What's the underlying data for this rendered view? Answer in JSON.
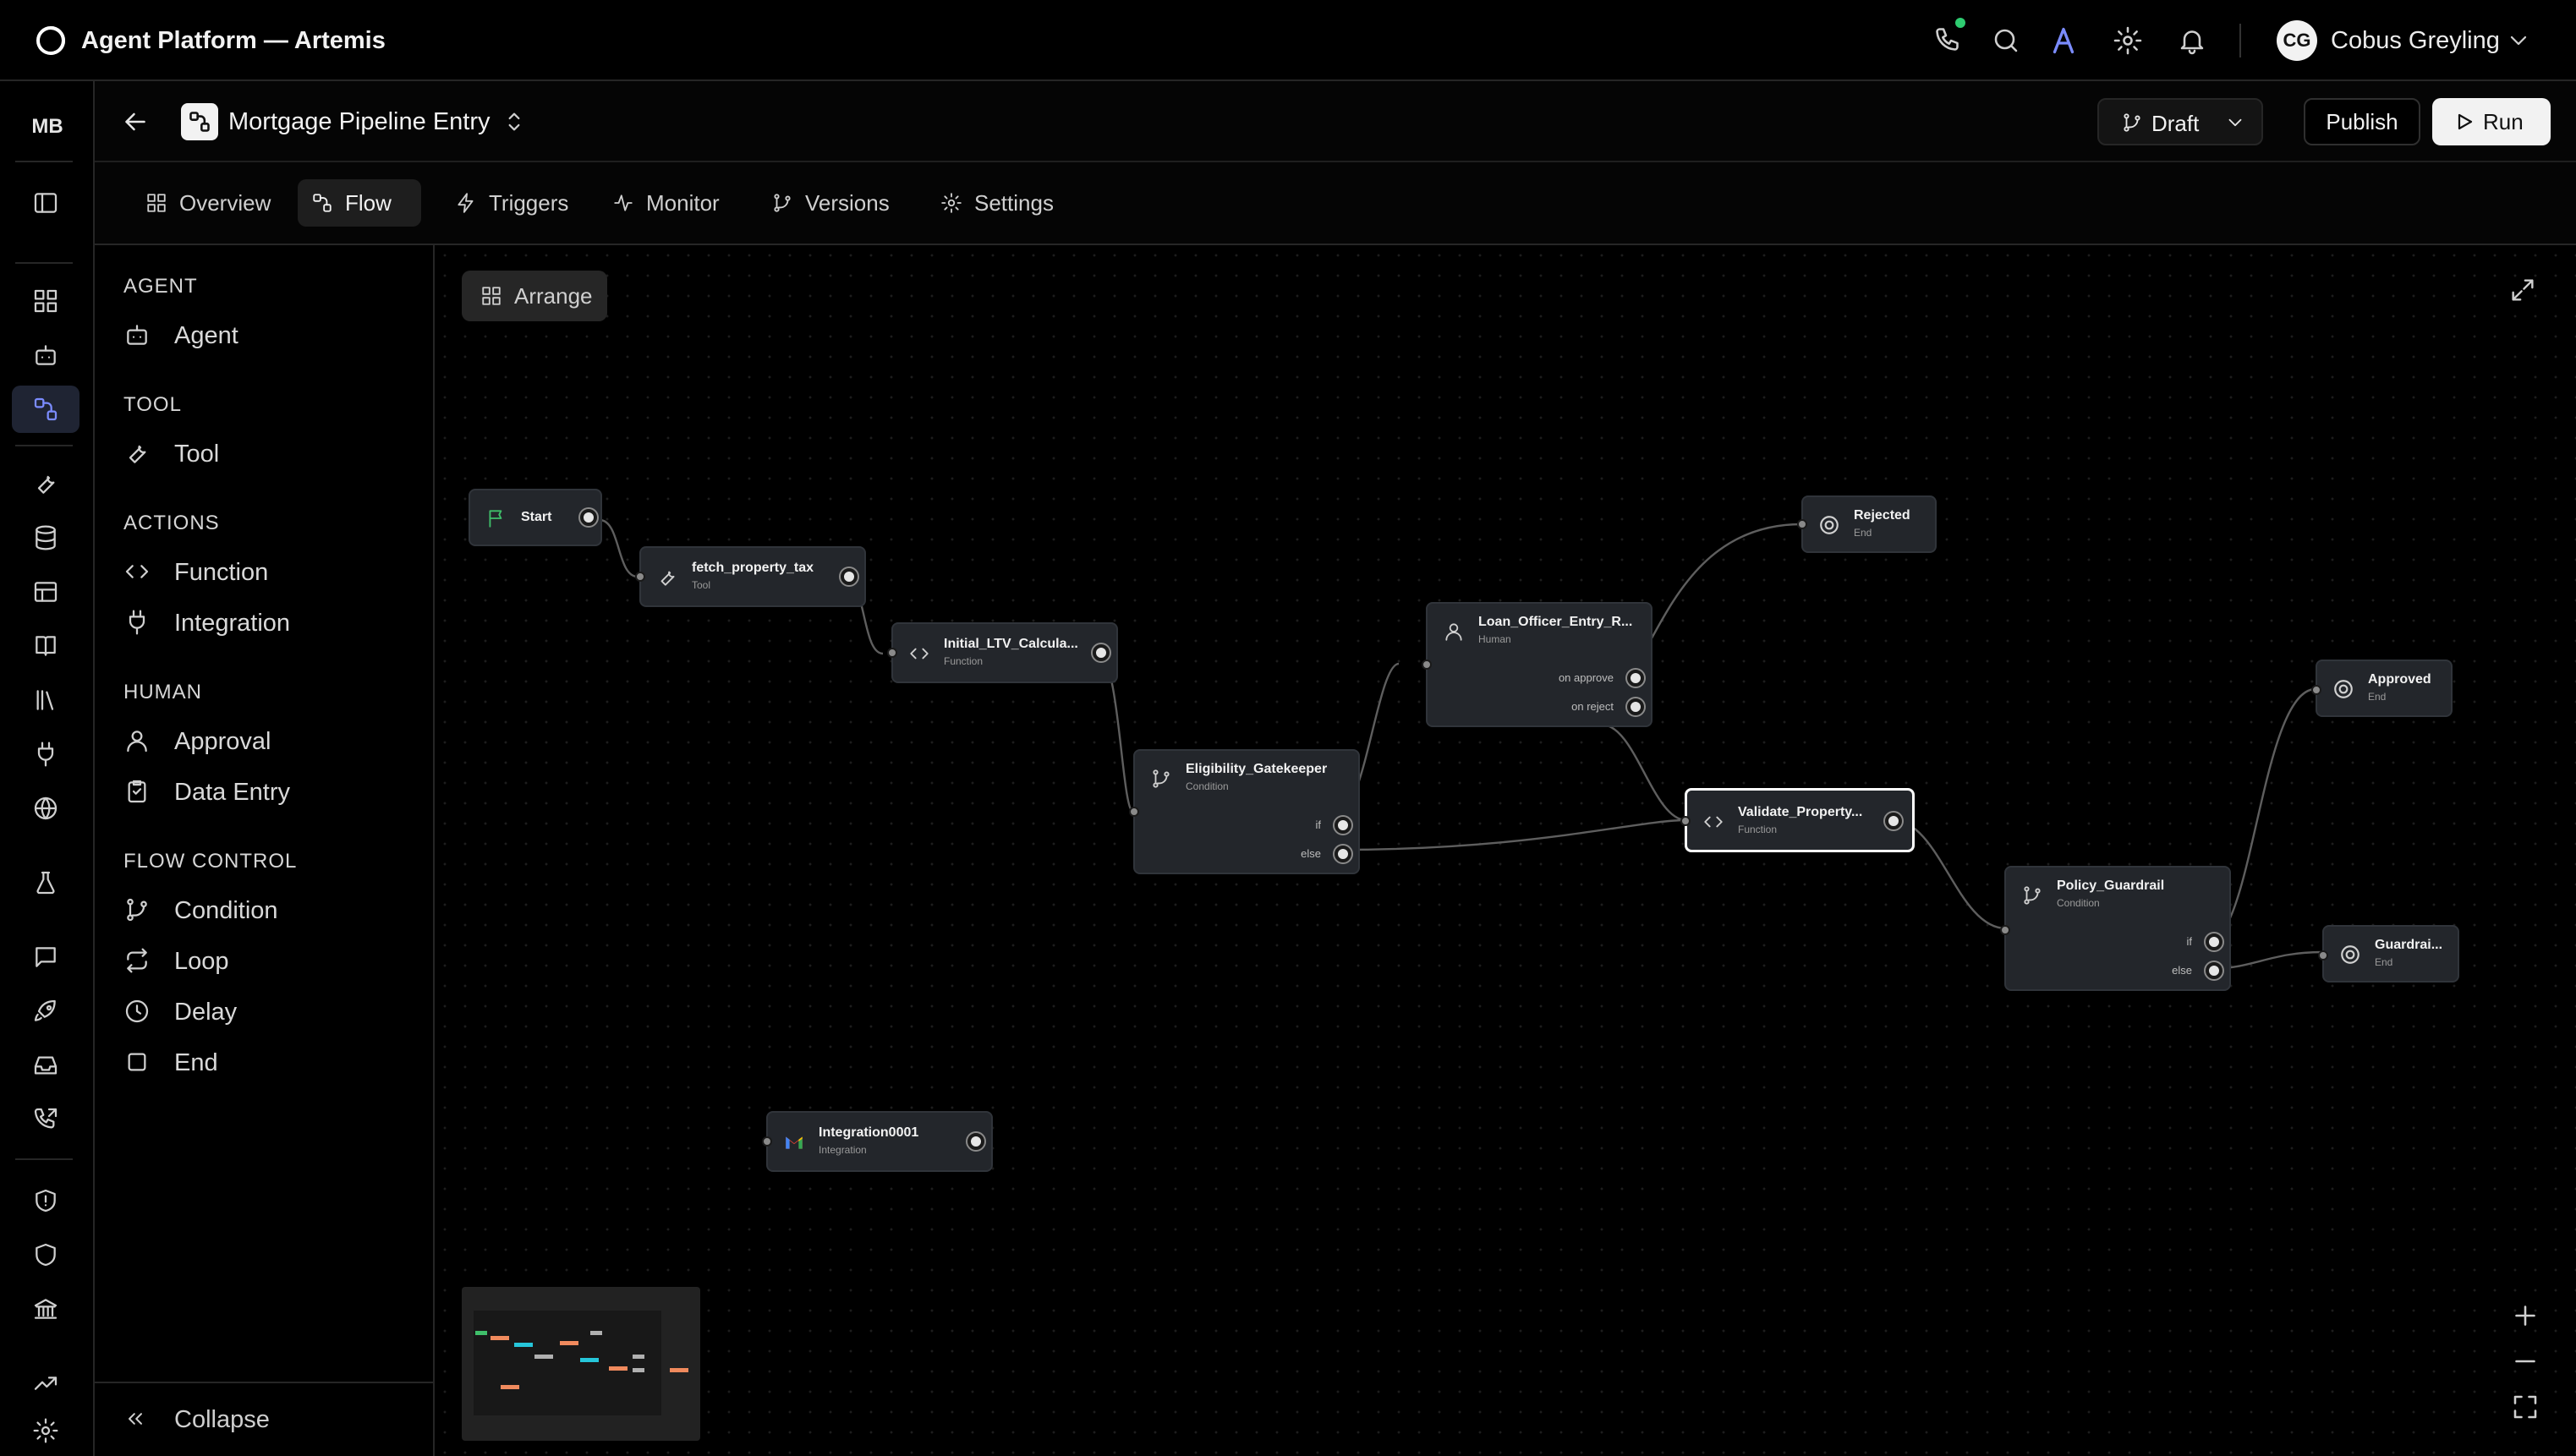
{
  "app": {
    "title": "Agent Platform — Artemis",
    "user_initials": "CG",
    "user_name": "Cobus Greyling",
    "workspace_initials": "MB"
  },
  "header": {
    "pipeline_name": "Mortgage Pipeline Entry",
    "version_label": "Draft",
    "publish_label": "Publish",
    "run_label": "Run"
  },
  "tabs": [
    {
      "label": "Overview",
      "icon": "grid-icon",
      "active": false
    },
    {
      "label": "Flow",
      "icon": "flow-icon",
      "active": true
    },
    {
      "label": "Triggers",
      "icon": "bolt-icon",
      "active": false
    },
    {
      "label": "Monitor",
      "icon": "activity-icon",
      "active": false
    },
    {
      "label": "Versions",
      "icon": "branch-icon",
      "active": false
    },
    {
      "label": "Settings",
      "icon": "gear-icon",
      "active": false
    }
  ],
  "palette": {
    "groups": [
      {
        "heading": "AGENT",
        "items": [
          {
            "label": "Agent",
            "icon": "bot-icon"
          }
        ]
      },
      {
        "heading": "TOOL",
        "items": [
          {
            "label": "Tool",
            "icon": "wrench-icon"
          }
        ]
      },
      {
        "heading": "ACTIONS",
        "items": [
          {
            "label": "Function",
            "icon": "code-icon"
          },
          {
            "label": "Integration",
            "icon": "plug-icon"
          }
        ]
      },
      {
        "heading": "HUMAN",
        "items": [
          {
            "label": "Approval",
            "icon": "person-icon"
          },
          {
            "label": "Data Entry",
            "icon": "form-icon"
          }
        ]
      },
      {
        "heading": "FLOW CONTROL",
        "items": [
          {
            "label": "Condition",
            "icon": "branch-icon"
          },
          {
            "label": "Loop",
            "icon": "loop-icon"
          },
          {
            "label": "Delay",
            "icon": "clock-icon"
          },
          {
            "label": "End",
            "icon": "square-icon"
          }
        ]
      }
    ],
    "collapse_label": "Collapse"
  },
  "canvas": {
    "arrange_label": "Arrange",
    "nodes": [
      {
        "id": "start",
        "title": "Start",
        "subtitle": ""
      },
      {
        "id": "fetch",
        "title": "fetch_property_tax",
        "subtitle": "Tool"
      },
      {
        "id": "ltv",
        "title": "Initial_LTV_Calcula...",
        "subtitle": "Function"
      },
      {
        "id": "elig",
        "title": "Eligibility_Gatekeeper",
        "subtitle": "Condition",
        "branches": [
          "if",
          "else"
        ]
      },
      {
        "id": "loan",
        "title": "Loan_Officer_Entry_R...",
        "subtitle": "Human",
        "branches": [
          "on approve",
          "on reject"
        ]
      },
      {
        "id": "rejected",
        "title": "Rejected",
        "subtitle": "End"
      },
      {
        "id": "validate",
        "title": "Validate_Property...",
        "subtitle": "Function"
      },
      {
        "id": "policy",
        "title": "Policy_Guardrail",
        "subtitle": "Condition",
        "branches": [
          "if",
          "else"
        ]
      },
      {
        "id": "approved",
        "title": "Approved",
        "subtitle": "End"
      },
      {
        "id": "guardrail",
        "title": "Guardrai...",
        "subtitle": "End"
      },
      {
        "id": "integration",
        "title": "Integration0001",
        "subtitle": "Integration"
      }
    ]
  },
  "colors": {
    "accent": "#7b8cff",
    "end_node": "#e0404a",
    "status_online": "#2ecc71"
  }
}
